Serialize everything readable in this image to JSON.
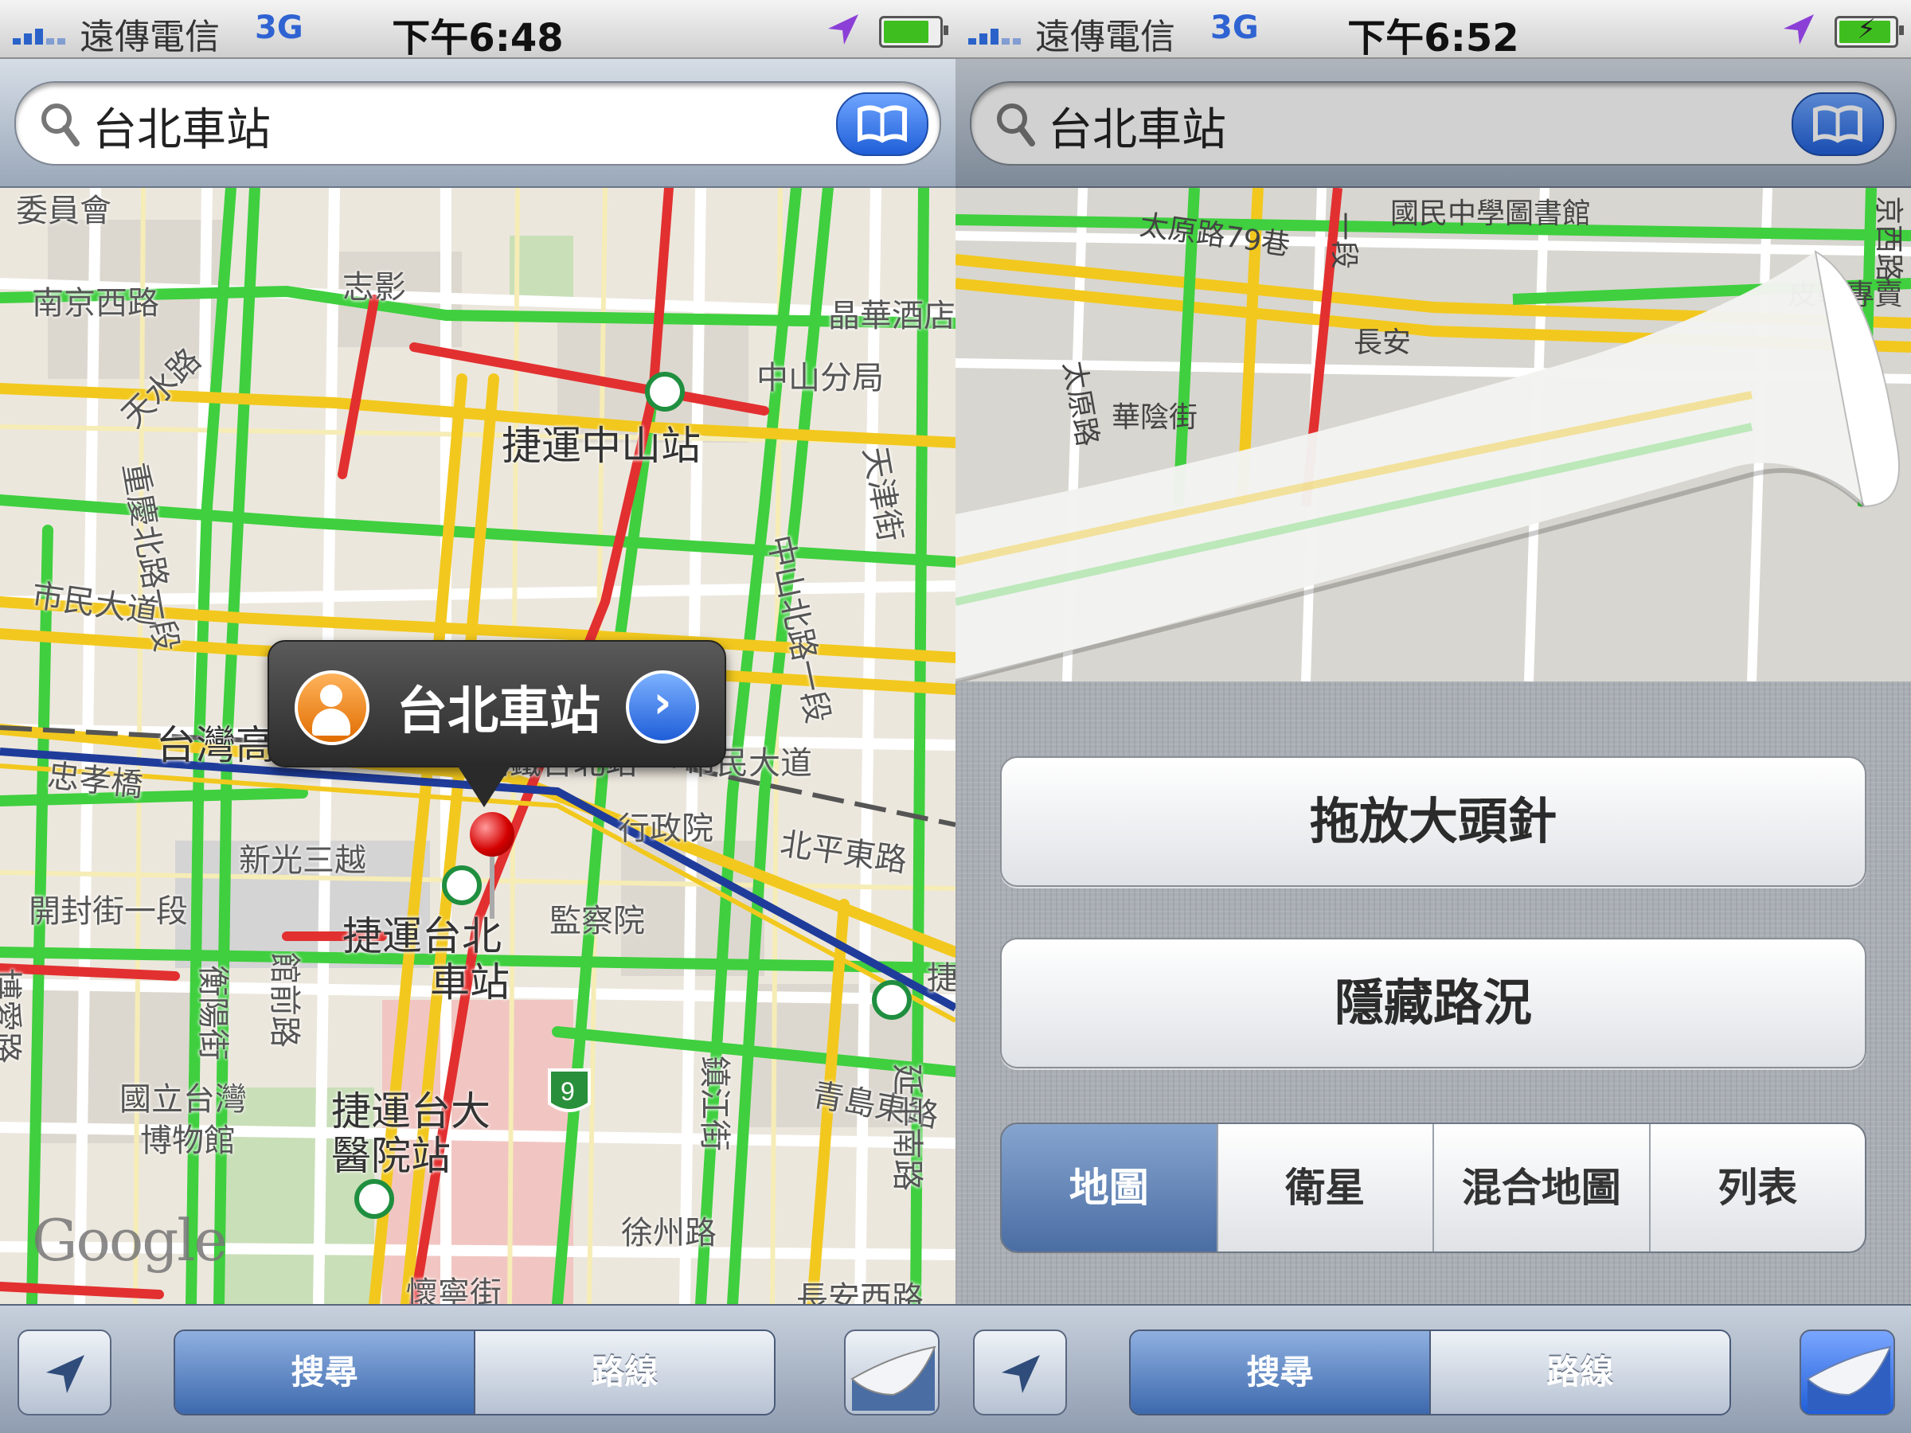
{
  "left_screen": {
    "status_bar": {
      "carrier": "遠傳電信",
      "network": "3G",
      "time": "下午6:48"
    },
    "search": {
      "query": "台北車站"
    },
    "callout": {
      "title": "台北車站"
    },
    "map_labels": {
      "nanjing_w": "南京西路",
      "zhiying": "志影",
      "jinghua": "晶華酒店",
      "zhongshan_branch": "中山分局",
      "tianshui": "天水路",
      "chongqing_n": "重慶北路一段",
      "mrt_zhongshan": "捷運中山站",
      "tianjin": "天津街",
      "zhongshan_n": "中山北路一段",
      "civic_blvd_1": "市民大道",
      "civic_blvd_2": "市民大道",
      "hsr": "台灣高鐵",
      "hsr_taipei": "高鐵台北站",
      "executive_yuan": "行政院",
      "beiping_e": "北平東路",
      "zhongxiao_w": "忠孝橋",
      "xinguang": "新光三越",
      "kaifeng": "開封街一段",
      "mrt_taipei_1": "捷運台北",
      "mrt_taipei_2": "車站",
      "museum_1": "國立台灣",
      "museum_2": "博物館",
      "mrt_ntuh_1": "捷運台大",
      "mrt_ntuh_2": "醫院站",
      "qingdao_e": "青島東路",
      "zhenjiang": "鎮江街",
      "xuzhou": "徐州路",
      "huaining": "懷寧街",
      "guanqian": "館前路",
      "hengyang": "衡陽街",
      "bo_ai": "博愛路",
      "chang_an": "長安西路",
      "mrt_shandao": "捷運善",
      "control_yuan": "監察院",
      "committee": "委員會",
      "yanping": "延平南路",
      "google": "Google"
    },
    "toolbar": {
      "search_label": "搜尋",
      "directions_label": "路線"
    }
  },
  "right_screen": {
    "status_bar": {
      "carrier": "遠傳電信",
      "network": "3G",
      "time": "下午6:52"
    },
    "search": {
      "query": "台北車站"
    },
    "map_labels": {
      "taiyuan_79": "太原路79巷",
      "library": "國民中學圖書館",
      "pixie": "皮鞋專賣",
      "taiyuan": "太原路",
      "huayin": "華陰街",
      "changan": "長安",
      "yiduan": "一段",
      "jingxi": "京西路"
    },
    "options": {
      "drop_pin": "拖放大頭針",
      "hide_traffic": "隱藏路況",
      "map_types": [
        "地圖",
        "衛星",
        "混合地圖",
        "列表"
      ],
      "selected_map_type": "地圖"
    },
    "toolbar": {
      "search_label": "搜尋",
      "directions_label": "路線"
    }
  },
  "colors": {
    "accent_blue": "#1f5ed8",
    "traffic_green": "#3fcf3f",
    "traffic_yellow": "#f2c81e",
    "traffic_red": "#e23030",
    "pin_red": "#d40000",
    "toolbar_selected": "#3d69ad"
  },
  "icons": [
    "signal-bars-icon",
    "location-arrow-icon",
    "battery-icon",
    "search-icon",
    "bookmarks-icon",
    "person-icon",
    "disclosure-arrow-icon",
    "map-pin-icon",
    "locate-me-icon",
    "page-curl-icon"
  ]
}
